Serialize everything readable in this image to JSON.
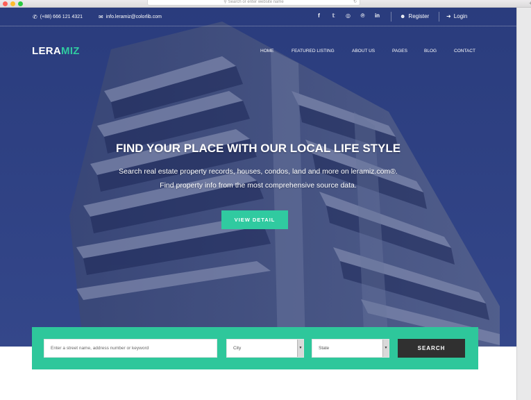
{
  "browser": {
    "address_placeholder": "Search or enter website name"
  },
  "topbar": {
    "phone": "(+88) 666 121 4321",
    "email": "info.leramiz@colorlib.com",
    "social_icons": [
      "facebook-icon",
      "twitter-icon",
      "instagram-icon",
      "pinterest-icon",
      "linkedin-icon"
    ],
    "social_glyphs": [
      "f",
      "𝕥",
      "◎",
      "℗",
      "in"
    ],
    "register_label": "Register",
    "login_label": "Login"
  },
  "header": {
    "logo_part1": "LERA",
    "logo_part2": "MIZ",
    "nav": [
      "HOME",
      "FEATURED LISTING",
      "ABOUT US",
      "PAGES",
      "BLOG",
      "CONTACT"
    ]
  },
  "hero": {
    "title": "FIND YOUR PLACE WITH OUR LOCAL LIFE STYLE",
    "subtitle_line1": "Search real estate property records, houses, condos, land and more on leramiz.com®.",
    "subtitle_line2": "Find property info from the most comprehensive source data.",
    "cta_label": "VIEW DETAIL"
  },
  "search": {
    "street_placeholder": "Enter a street name, address number or keyword",
    "city_value": "City",
    "state_value": "State",
    "button_label": "SEARCH"
  },
  "colors": {
    "accent": "#30caa0",
    "hero_overlay": "#25356e",
    "search_button": "#303030"
  }
}
